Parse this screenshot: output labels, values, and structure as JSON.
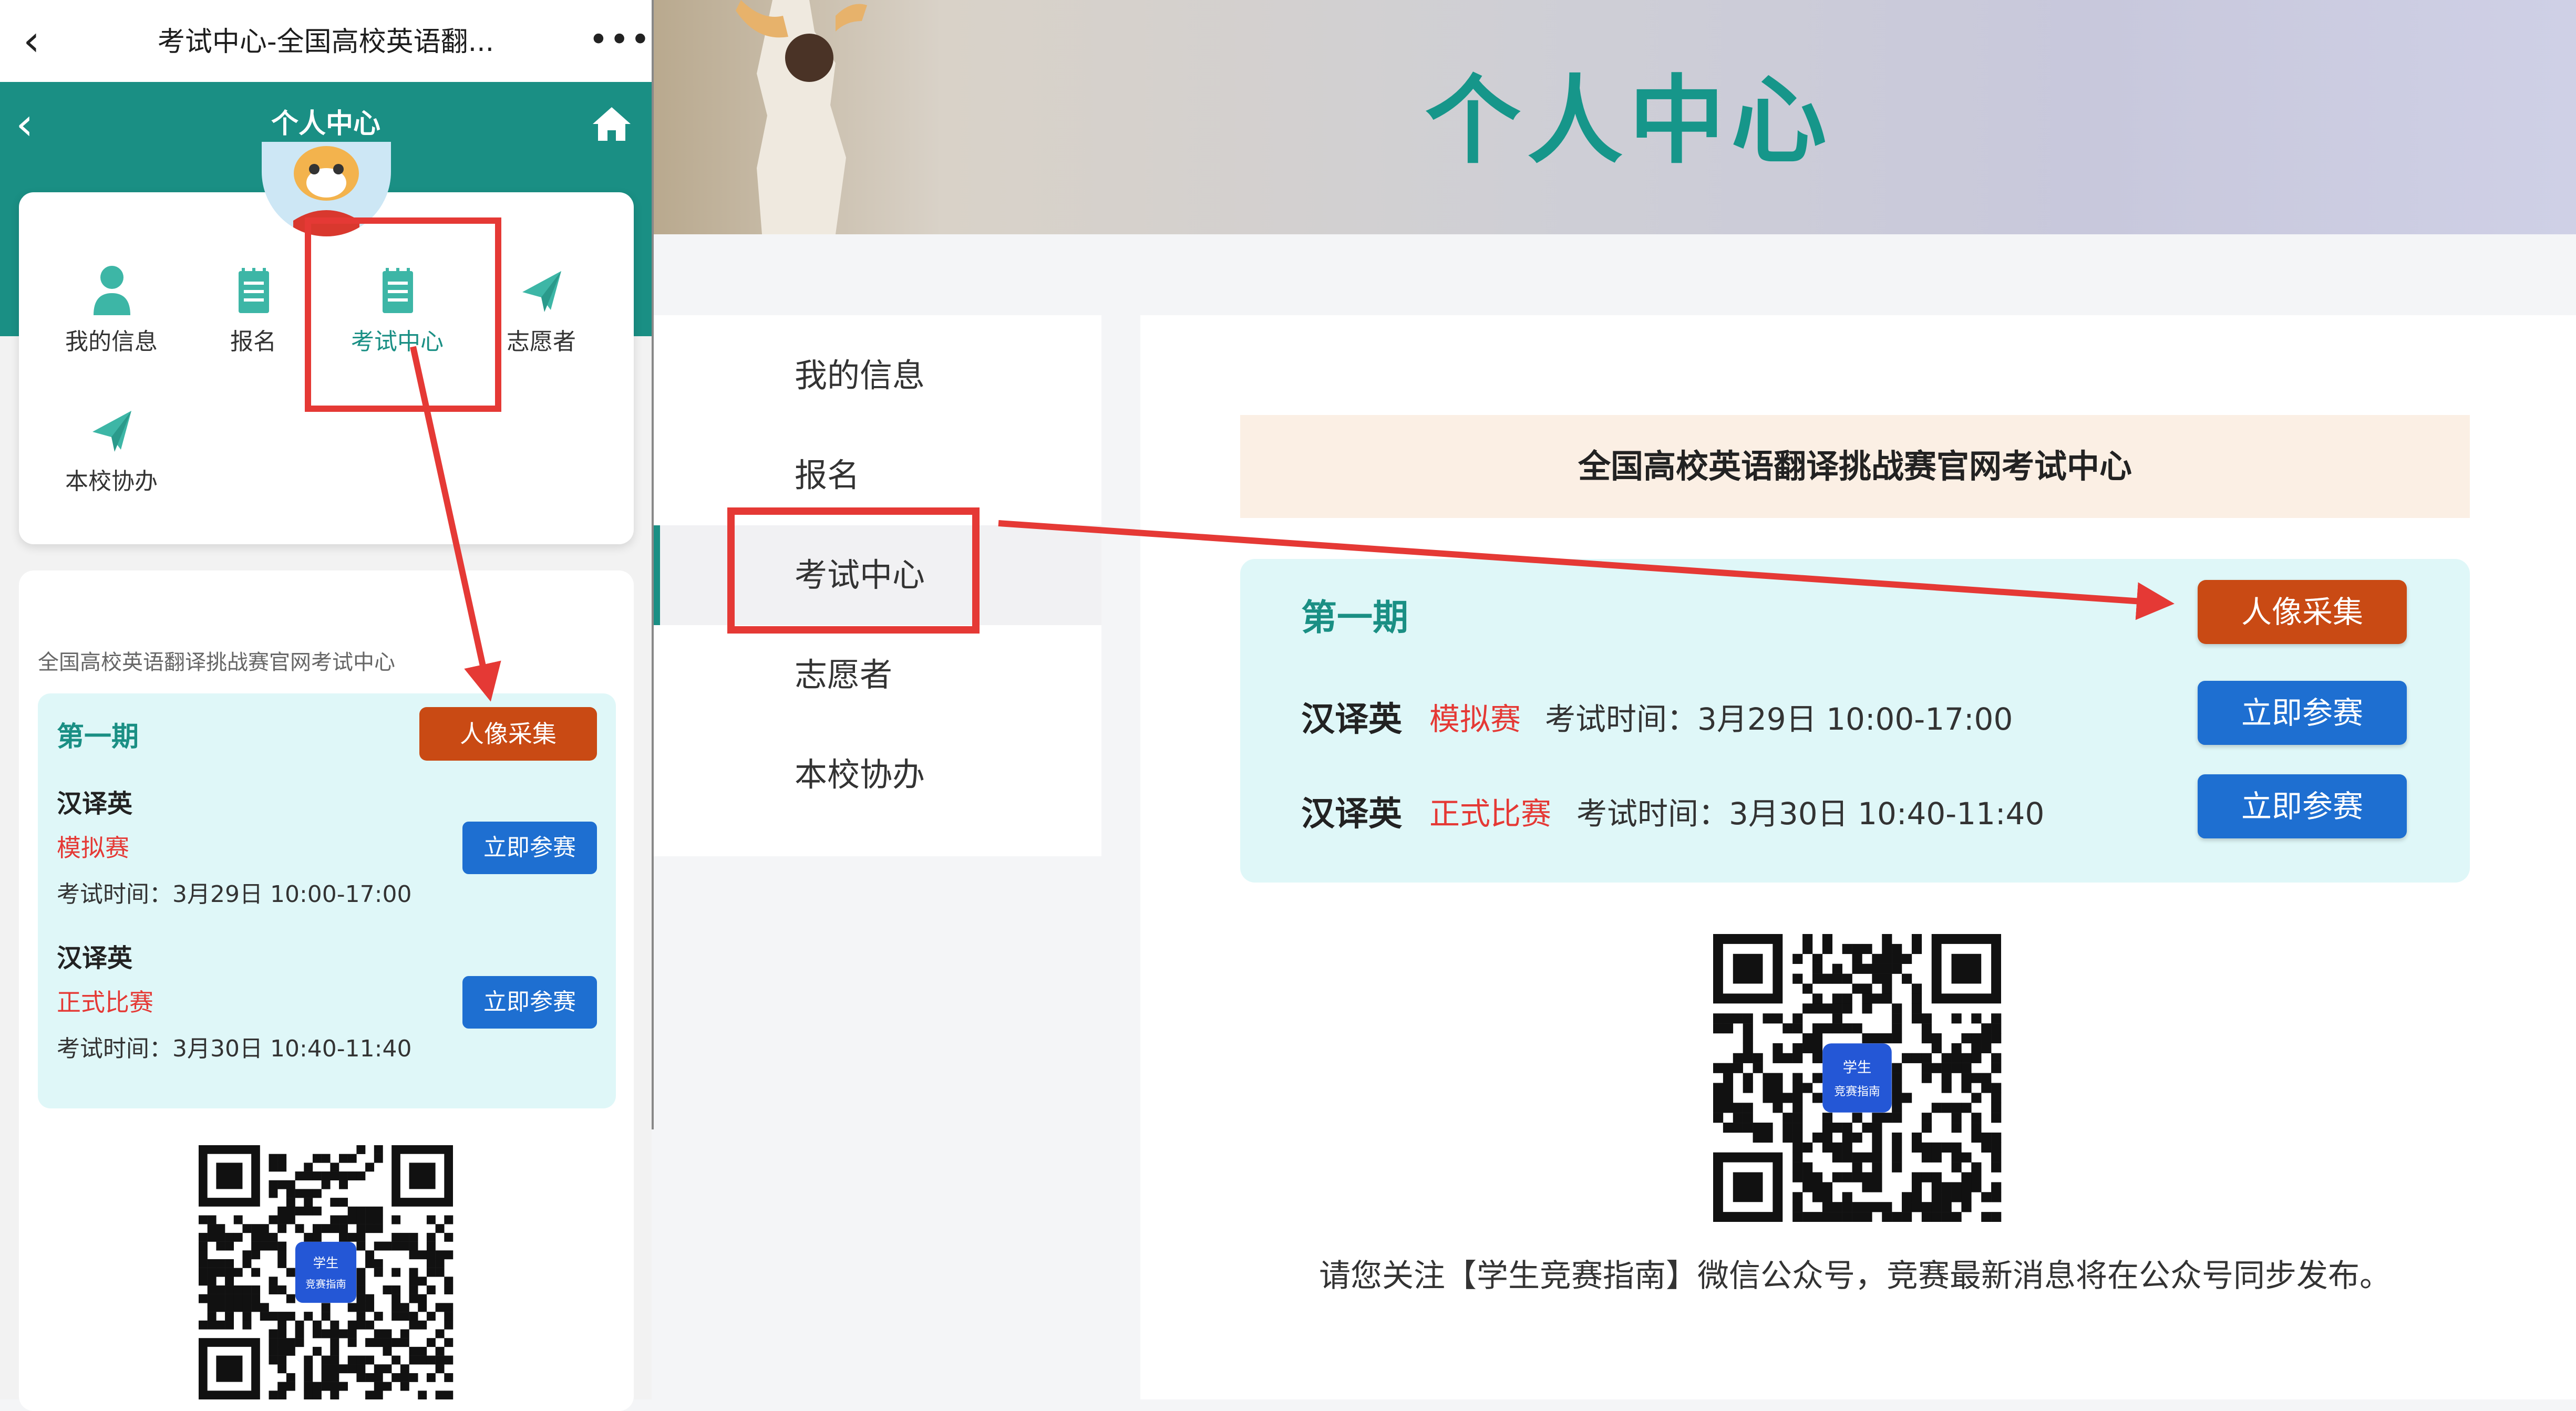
{
  "colors": {
    "teal": "#1a8f84",
    "highlight_red": "#e53935",
    "portrait_button": "#c94a14",
    "join_button": "#1e6fd1",
    "period_bg": "#dff7f8",
    "title_bar_bg": "#fbefe4"
  },
  "mobile": {
    "wechat_bar": {
      "back_icon": "chevron-left-icon",
      "title": "考试中心-全国高校英语翻...",
      "more": "•••"
    },
    "header": {
      "back_icon": "chevron-left-icon",
      "title": "个人中心",
      "home_icon": "home-icon"
    },
    "menu": [
      {
        "label": "我的信息",
        "icon": "user-icon"
      },
      {
        "label": "报名",
        "icon": "notepad-icon"
      },
      {
        "label": "考试中心",
        "icon": "notepad-icon",
        "active": true
      },
      {
        "label": "志愿者",
        "icon": "paper-plane-icon"
      },
      {
        "label": "本校协办",
        "icon": "paper-plane-icon"
      }
    ],
    "exam": {
      "section_title": "全国高校英语翻译挑战赛官网考试中心",
      "period": "第一期",
      "portrait_button": "人像采集",
      "items": [
        {
          "subject": "汉译英",
          "type": "模拟赛",
          "time": "考试时间：3月29日 10:00-17:00",
          "button": "立即参赛"
        },
        {
          "subject": "汉译英",
          "type": "正式比赛",
          "time": "考试时间：3月30日 10:40-11:40",
          "button": "立即参赛"
        }
      ]
    },
    "qr_badge": [
      "学生",
      "竞赛指南"
    ]
  },
  "desktop": {
    "banner_title": "个人中心",
    "nav": [
      {
        "label": "我的信息"
      },
      {
        "label": "报名"
      },
      {
        "label": "考试中心",
        "active": true
      },
      {
        "label": "志愿者"
      },
      {
        "label": "本校协办"
      }
    ],
    "main": {
      "title": "全国高校英语翻译挑战赛官网考试中心",
      "period": "第一期",
      "portrait_button": "人像采集",
      "items": [
        {
          "subject": "汉译英",
          "type": "模拟赛",
          "time": "考试时间：3月29日 10:00-17:00",
          "button": "立即参赛"
        },
        {
          "subject": "汉译英",
          "type": "正式比赛",
          "time": "考试时间：3月30日 10:40-11:40",
          "button": "立即参赛"
        }
      ],
      "qr_badge": [
        "学生",
        "竞赛指南"
      ],
      "notice": "请您关注【学生竞赛指南】微信公众号，竞赛最新消息将在公众号同步发布。"
    }
  }
}
